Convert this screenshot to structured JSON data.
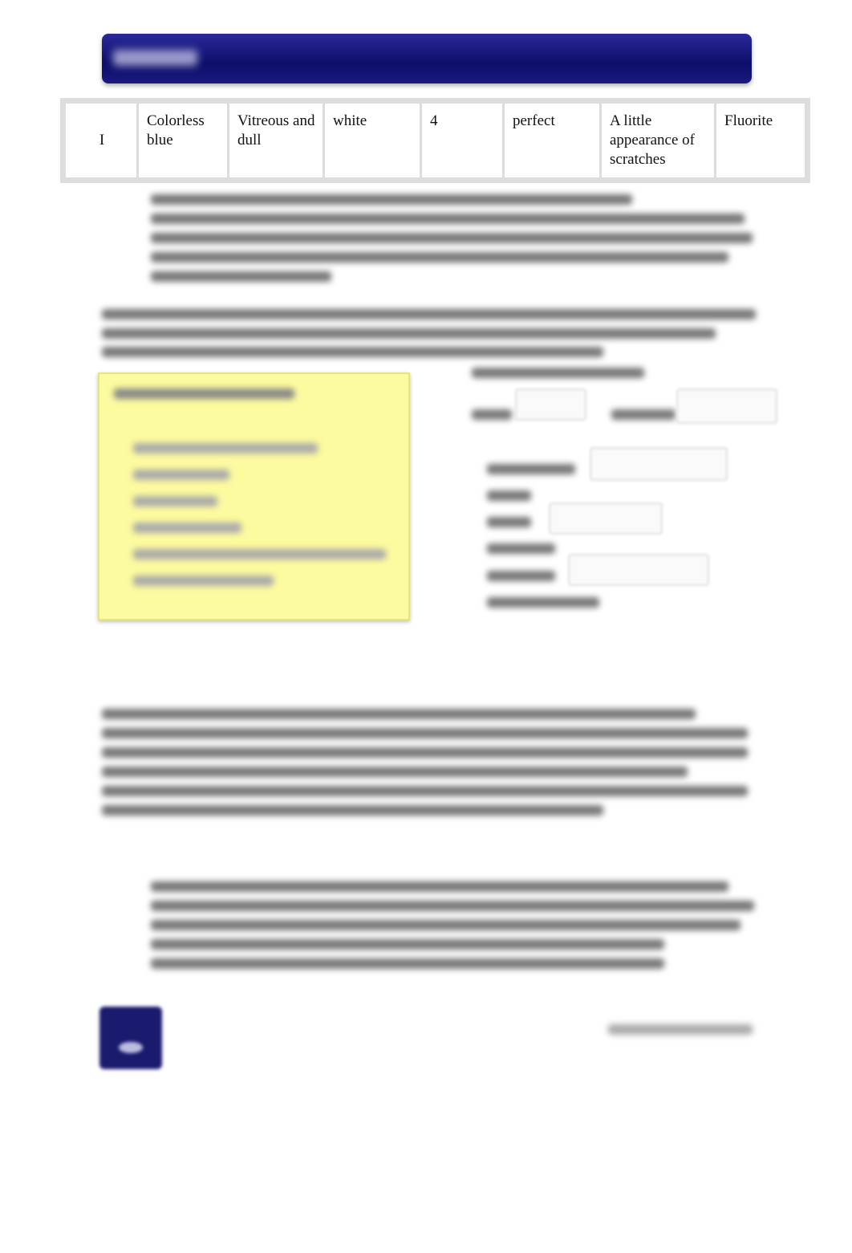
{
  "table": {
    "rows": [
      [
        "I",
        "Colorless blue",
        "Vitreous and dull",
        "white",
        "4",
        "perfect",
        "A little appearance of scratches",
        "Fluorite"
      ]
    ]
  },
  "colors": {
    "banner": "#0d0d6a",
    "highlight_box": "#fdfb9f"
  }
}
